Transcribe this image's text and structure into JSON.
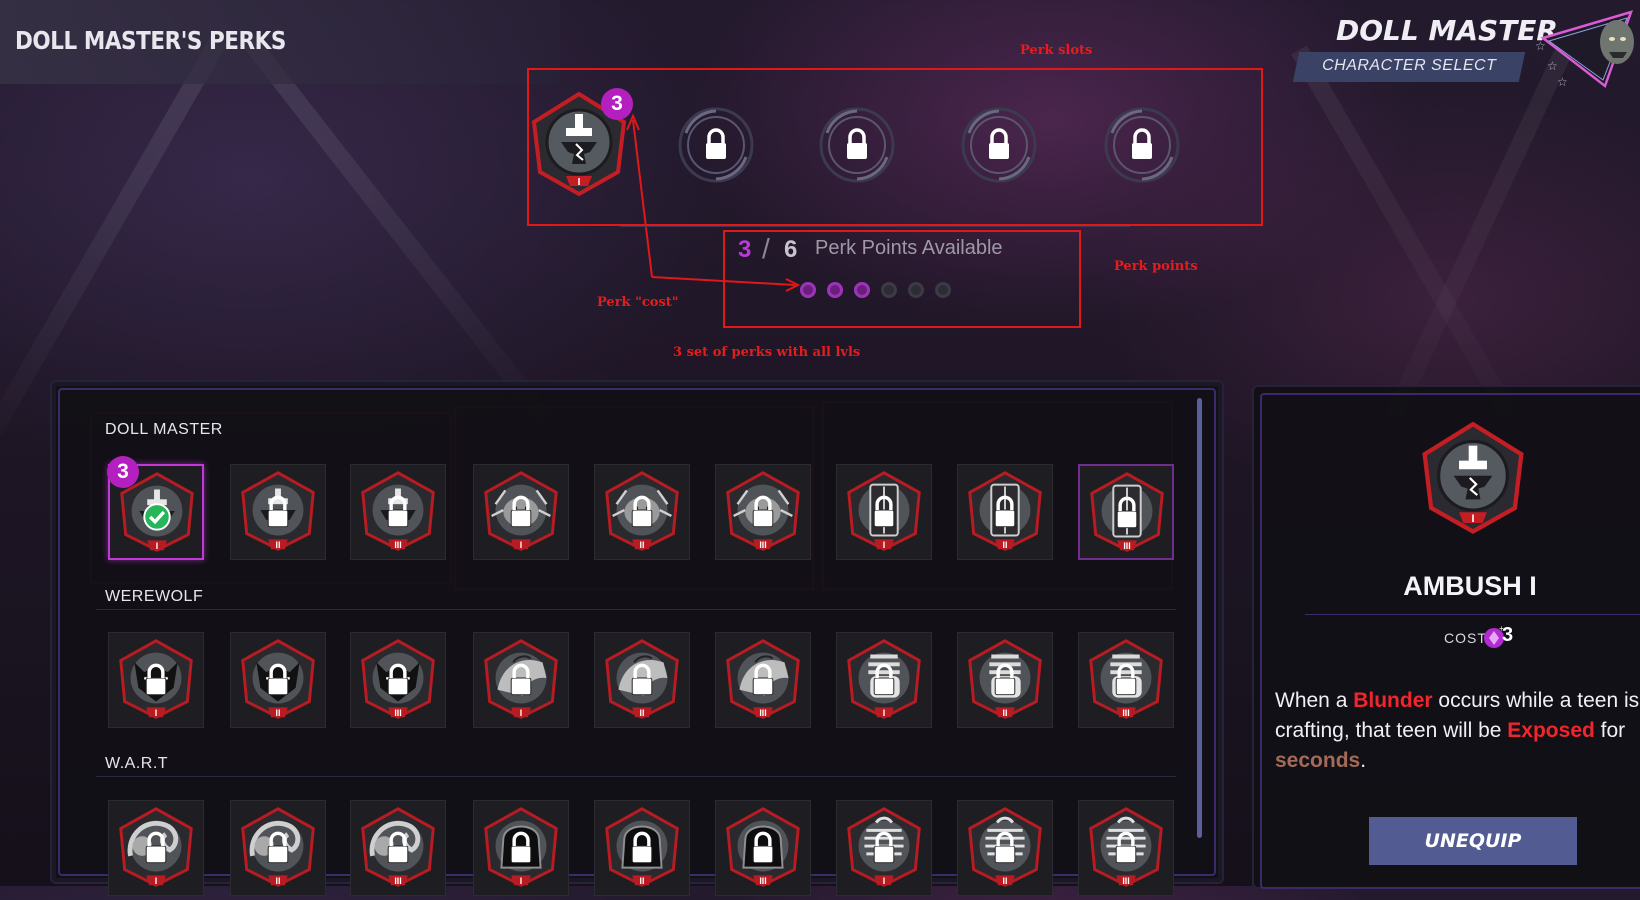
{
  "header": {
    "page_title": "DOLL MASTER'S PERKS",
    "character_name": "DOLL MASTER",
    "character_select_label": "CHARACTER SELECT"
  },
  "slots": {
    "equipped": {
      "perk": "Ambush",
      "level": "I",
      "cost_badge": "3"
    },
    "locked_count": 4
  },
  "points": {
    "used": "3",
    "separator": "/",
    "max": "6",
    "label": "Perk Points Available",
    "dots_filled": 3,
    "dots_total": 6
  },
  "annotations": {
    "perk_slots": "Perk slots",
    "perk_points": "Perk points",
    "perk_cost": "Perk \"cost\"",
    "perk_sets": "3 set of perks with all lvls"
  },
  "categories": [
    {
      "name": "DOLL MASTER",
      "badge": "3",
      "perks": [
        {
          "icon": "anvil-hammer",
          "level": "I",
          "state": "equipped"
        },
        {
          "icon": "anvil-hammer",
          "level": "II",
          "state": "locked"
        },
        {
          "icon": "anvil-hammer",
          "level": "III",
          "state": "locked"
        },
        {
          "icon": "spider-beast",
          "level": "I",
          "state": "locked"
        },
        {
          "icon": "spider-beast",
          "level": "II",
          "state": "locked"
        },
        {
          "icon": "spider-beast",
          "level": "III",
          "state": "locked"
        },
        {
          "icon": "locker",
          "level": "I",
          "state": "locked"
        },
        {
          "icon": "locker",
          "level": "II",
          "state": "locked"
        },
        {
          "icon": "locker",
          "level": "III",
          "state": "locked-highlight"
        }
      ]
    },
    {
      "name": "WEREWOLF",
      "perks": [
        {
          "icon": "wolf-face",
          "level": "I",
          "state": "locked"
        },
        {
          "icon": "wolf-face",
          "level": "II",
          "state": "locked"
        },
        {
          "icon": "wolf-face",
          "level": "III",
          "state": "locked"
        },
        {
          "icon": "wolf-howl",
          "level": "I",
          "state": "locked"
        },
        {
          "icon": "wolf-howl",
          "level": "II",
          "state": "locked"
        },
        {
          "icon": "wolf-howl",
          "level": "III",
          "state": "locked"
        },
        {
          "icon": "clenched-fist",
          "level": "I",
          "state": "locked"
        },
        {
          "icon": "clenched-fist",
          "level": "II",
          "state": "locked"
        },
        {
          "icon": "clenched-fist",
          "level": "III",
          "state": "locked"
        }
      ]
    },
    {
      "name": "W.A.R.T",
      "perks": [
        {
          "icon": "curly-hair",
          "level": "I",
          "state": "locked"
        },
        {
          "icon": "curly-hair",
          "level": "II",
          "state": "locked"
        },
        {
          "icon": "curly-hair",
          "level": "III",
          "state": "locked"
        },
        {
          "icon": "hooded-face",
          "level": "I",
          "state": "locked"
        },
        {
          "icon": "hooded-face",
          "level": "II",
          "state": "locked"
        },
        {
          "icon": "hooded-face",
          "level": "III",
          "state": "locked"
        },
        {
          "icon": "striped-figure",
          "level": "I",
          "state": "locked"
        },
        {
          "icon": "striped-figure",
          "level": "II",
          "state": "locked"
        },
        {
          "icon": "striped-figure",
          "level": "III",
          "state": "locked"
        }
      ]
    }
  ],
  "detail": {
    "name": "AMBUSH I",
    "level": "I",
    "cost_label": "COST",
    "cost_value": "3",
    "desc": {
      "p1": "When a ",
      "k1": "Blunder",
      "p2": " occurs while a teen is",
      "p3": "crafting, that teen will be ",
      "k2": "Exposed",
      "p4": " for",
      "k3": "seconds",
      "p5": "."
    },
    "button_label": "UNEQUIP"
  },
  "colors": {
    "accent_purple": "#b41fbf",
    "annotation_red": "#e01818",
    "keyword_red": "#f0262c",
    "button_blue": "#525b92"
  }
}
